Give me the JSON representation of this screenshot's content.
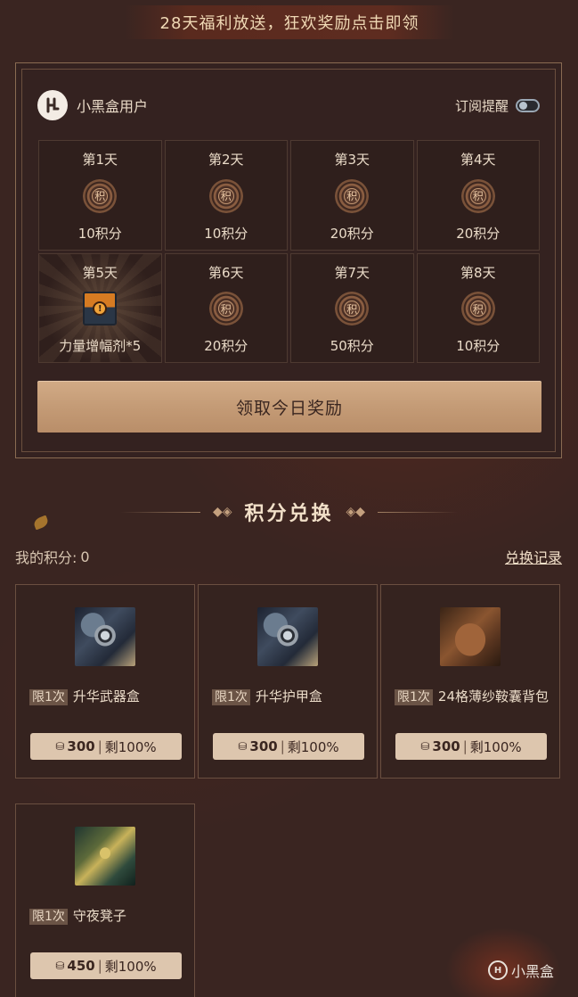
{
  "banner": {
    "text": "28天福利放送，狂欢奖励点击即领"
  },
  "card": {
    "username": "小黑盒用户",
    "subscribe_label": "订阅提醒",
    "subscribe_on": false,
    "days": [
      {
        "title": "第1天",
        "reward": "10积分",
        "icon": "points-coin-icon"
      },
      {
        "title": "第2天",
        "reward": "10积分",
        "icon": "points-coin-icon"
      },
      {
        "title": "第3天",
        "reward": "20积分",
        "icon": "points-coin-icon"
      },
      {
        "title": "第4天",
        "reward": "20积分",
        "icon": "points-coin-icon"
      },
      {
        "title": "第5天",
        "reward": "力量增幅剂*5",
        "icon": "potion-icon"
      },
      {
        "title": "第6天",
        "reward": "20积分",
        "icon": "points-coin-icon"
      },
      {
        "title": "第7天",
        "reward": "50积分",
        "icon": "points-coin-icon"
      },
      {
        "title": "第8天",
        "reward": "10积分",
        "icon": "points-coin-icon"
      }
    ],
    "coin_char": "积",
    "claim_label": "领取今日奖励"
  },
  "exchange": {
    "title": "积分兑换",
    "my_points_label": "我的积分:",
    "my_points_value": "0",
    "history_label": "兑换记录",
    "items": [
      {
        "limit": "限1次",
        "name": "升华武器盒",
        "price": "300",
        "remaining": "剩100%",
        "image": "weapon-box-image"
      },
      {
        "limit": "限1次",
        "name": "升华护甲盒",
        "price": "300",
        "remaining": "剩100%",
        "image": "armor-box-image"
      },
      {
        "limit": "限1次",
        "name": "24格薄纱鞍囊背包",
        "price": "300",
        "remaining": "剩100%",
        "image": "saddlebag-image"
      },
      {
        "limit": "限1次",
        "name": "守夜凳子",
        "price": "450",
        "remaining": "剩100%",
        "image": "stool-image"
      }
    ]
  },
  "watermark": {
    "text": "小黑盒"
  },
  "colors": {
    "background": "#3a2521",
    "accent": "#c49b76",
    "text": "#eadbc8"
  }
}
